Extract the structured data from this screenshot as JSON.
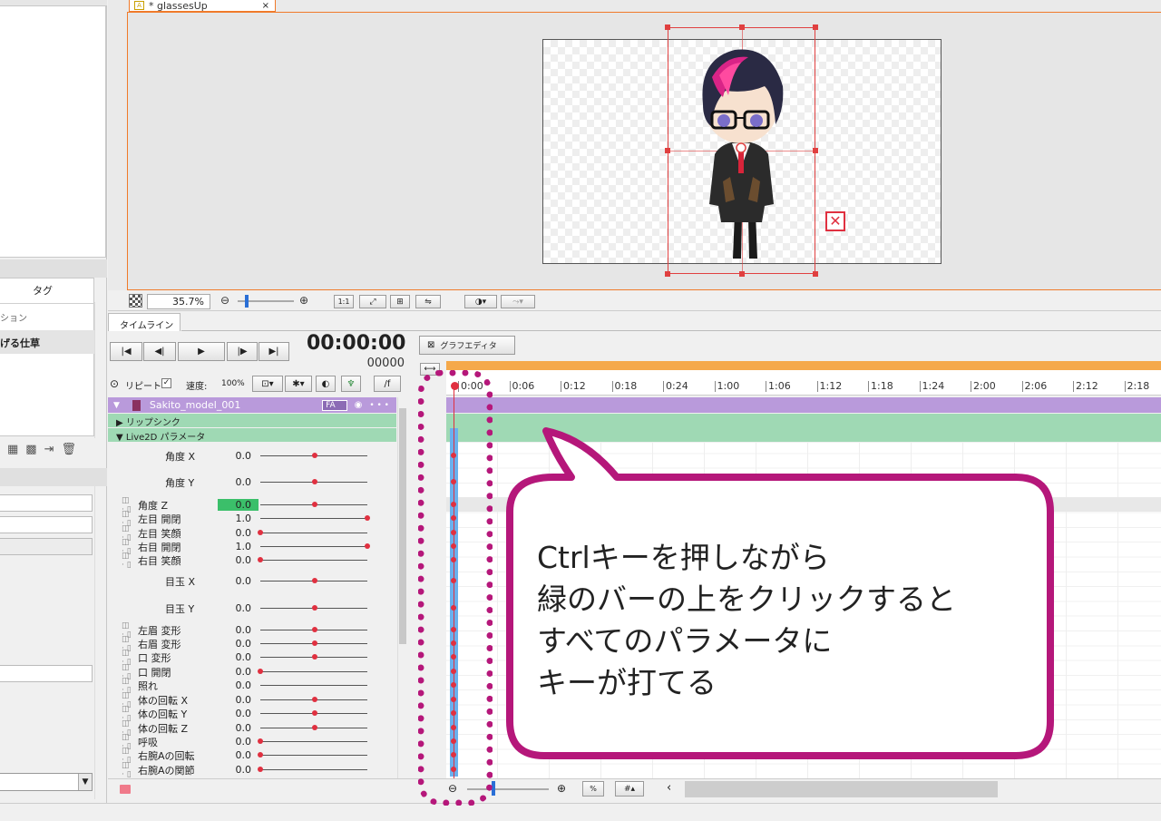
{
  "file_tab": {
    "label": "* glassesUp",
    "close": "×"
  },
  "canvas_toolbar": {
    "zoom": "35.7",
    "zoom_unit": "%",
    "actual_size": "1:1"
  },
  "left_panel": {
    "tag_header": "タグ",
    "item1": "ション",
    "item2": "げる仕草"
  },
  "timeline": {
    "tab_label": "タイムライン",
    "timecode": "00:00:00",
    "frame": "00000",
    "graph_editor": "グラフエディタ",
    "repeat_label": "リピート",
    "speed_label": "速度:",
    "speed_value": "100%",
    "fx_label": "/f",
    "model_name": "Sakito_model_001",
    "model_badge": "FA",
    "group_lipsync": "▶ リップシンク",
    "group_params": "▼ Live2D パラメータ",
    "ruler": [
      "0:00",
      "0:06",
      "0:12",
      "0:18",
      "0:24",
      "1:00",
      "1:06",
      "1:12",
      "1:18",
      "1:24",
      "2:00",
      "2:06",
      "2:12",
      "2:18"
    ]
  },
  "params": [
    {
      "name": "角度 X",
      "value": "0.0"
    },
    {
      "name": "角度 Y",
      "value": "0.0"
    },
    {
      "name": "角度 Z",
      "value": "0.0"
    },
    {
      "name": "左目 開閉",
      "value": "1.0"
    },
    {
      "name": "左目 笑顔",
      "value": "0.0"
    },
    {
      "name": "右目 開閉",
      "value": "1.0"
    },
    {
      "name": "右目 笑顔",
      "value": "0.0"
    },
    {
      "name": "目玉 X",
      "value": "0.0"
    },
    {
      "name": "目玉 Y",
      "value": "0.0"
    },
    {
      "name": "左眉 変形",
      "value": "0.0"
    },
    {
      "name": "右眉 変形",
      "value": "0.0"
    },
    {
      "name": "口 変形",
      "value": "0.0"
    },
    {
      "name": "口 開閉",
      "value": "0.0"
    },
    {
      "name": "照れ",
      "value": "0.0"
    },
    {
      "name": "体の回転 X",
      "value": "0.0"
    },
    {
      "name": "体の回転 Y",
      "value": "0.0"
    },
    {
      "name": "体の回転 Z",
      "value": "0.0"
    },
    {
      "name": "呼吸",
      "value": "0.0"
    },
    {
      "name": "右腕Aの回転",
      "value": "0.0"
    },
    {
      "name": "右腕Aの関節",
      "value": "0.0"
    }
  ],
  "callout": {
    "line1": "Ctrlキーを押しながら",
    "line2": "緑のバーの上をクリックすると",
    "line3": "すべてのパラメータに",
    "line4": "キーが打てる"
  },
  "colors": {
    "accent": "#f07a2a",
    "callout_border": "#b5177a",
    "green_bar": "#9fd9b4",
    "keyframe": "#e03040"
  }
}
